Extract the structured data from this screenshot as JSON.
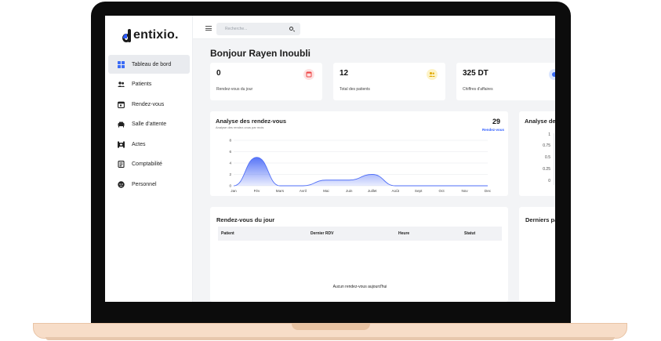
{
  "app": {
    "brand": "entixio."
  },
  "search": {
    "placeholder": "Recherche..."
  },
  "sidebar": {
    "items": [
      {
        "label": "Tableau de bord",
        "icon": "dashboard-icon",
        "active": true
      },
      {
        "label": "Patients",
        "icon": "users-icon"
      },
      {
        "label": "Rendez-vous",
        "icon": "calendar-icon"
      },
      {
        "label": "Salle d'attente",
        "icon": "sofa-icon"
      },
      {
        "label": "Actes",
        "icon": "procedure-icon"
      },
      {
        "label": "Comptabilité",
        "icon": "ledger-icon"
      },
      {
        "label": "Personnel",
        "icon": "staff-icon"
      }
    ]
  },
  "greeting": "Bonjour Rayen Inoubli",
  "stats": [
    {
      "value": "0",
      "label": "Rendez-vous du jour",
      "icon": "calendar-icon",
      "color": "#fde2e2",
      "icon_color": "#ef4444"
    },
    {
      "value": "12",
      "label": "Total des patients",
      "icon": "users-icon",
      "color": "#fdf3c7",
      "icon_color": "#e0a800"
    },
    {
      "value": "325 DT",
      "label": "Chiffres d'affaires",
      "icon": "money-icon",
      "color": "#dbe6ff",
      "icon_color": "#3b6cf6"
    }
  ],
  "appointments_chart": {
    "title": "Analyse des rendez-vous",
    "subtitle": "Analyse des rendez-vous par mois",
    "total": "29",
    "total_label": "Rendez-vous",
    "color": "#4f6ef7"
  },
  "side_chart": {
    "title": "Analyse de",
    "ticks": [
      "1",
      "0.75",
      "0.5",
      "0.25",
      "0"
    ]
  },
  "chart_data": {
    "type": "area",
    "categories": [
      "Jan",
      "Fév",
      "Mars",
      "Avril",
      "Mai",
      "Juin",
      "Juillet",
      "Août",
      "Sept",
      "Oct",
      "Nov",
      "Dec"
    ],
    "series": [
      {
        "values": [
          0,
          5,
          0,
          0,
          1,
          1,
          2,
          0,
          0,
          0,
          0,
          0
        ]
      }
    ],
    "yticks": [
      "0",
      "2",
      "4",
      "6",
      "8"
    ],
    "ylim": [
      0,
      8
    ],
    "grid": true
  },
  "today_table": {
    "title": "Rendez-vous du jour",
    "columns": [
      "Patient",
      "Dernier RDV",
      "Heure",
      "Statut"
    ],
    "empty_message": "Aucun rendez-vous aujourd'hui"
  },
  "last_panel": {
    "title": "Derniers pa"
  }
}
